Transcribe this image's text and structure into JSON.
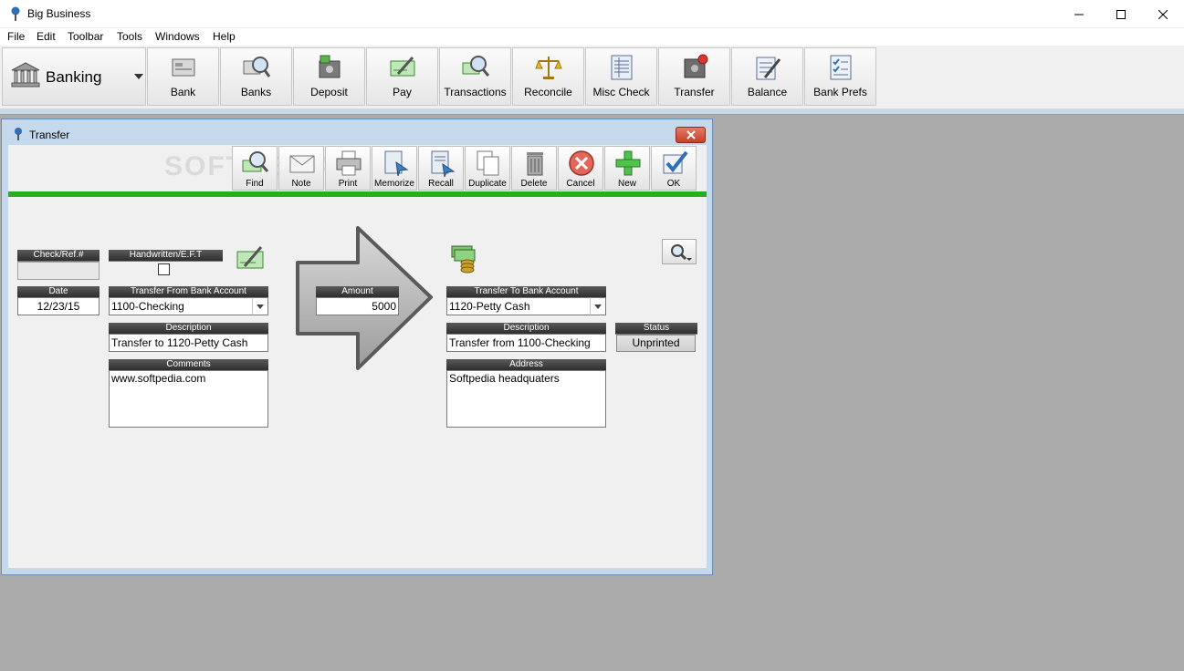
{
  "window": {
    "title": "Big Business"
  },
  "menu": [
    "File",
    "Edit",
    "Toolbar",
    "Tools",
    "Windows",
    "Help"
  ],
  "module": {
    "label": "Banking"
  },
  "toolbar": [
    {
      "label": "Bank",
      "icon": "bank-icon"
    },
    {
      "label": "Banks",
      "icon": "banks-search-icon"
    },
    {
      "label": "Deposit",
      "icon": "deposit-icon"
    },
    {
      "label": "Pay",
      "icon": "pay-icon"
    },
    {
      "label": "Transactions",
      "icon": "transactions-icon"
    },
    {
      "label": "Reconcile",
      "icon": "scales-icon"
    },
    {
      "label": "Misc Check",
      "icon": "misc-check-icon"
    },
    {
      "label": "Transfer",
      "icon": "transfer-icon"
    },
    {
      "label": "Balance",
      "icon": "balance-icon"
    },
    {
      "label": "Bank Prefs",
      "icon": "bank-prefs-icon"
    }
  ],
  "child": {
    "title": "Transfer",
    "toolbar": [
      {
        "label": "Find"
      },
      {
        "label": "Note"
      },
      {
        "label": "Print"
      },
      {
        "label": "Memorize"
      },
      {
        "label": "Recall"
      },
      {
        "label": "Duplicate"
      },
      {
        "label": "Delete"
      },
      {
        "label": "Cancel"
      },
      {
        "label": "New"
      },
      {
        "label": "OK"
      }
    ],
    "watermark": "SOFTPEDIA"
  },
  "form": {
    "check_ref": {
      "label": "Check/Ref.#",
      "value": ""
    },
    "handwritten": {
      "label": "Handwritten/E.F.T",
      "checked": false
    },
    "date": {
      "label": "Date",
      "value": "12/23/15"
    },
    "from_account": {
      "label": "Transfer From Bank Account",
      "value": "1100-Checking"
    },
    "from_description": {
      "label": "Description",
      "value": "Transfer to 1120-Petty Cash"
    },
    "comments": {
      "label": "Comments",
      "value": "www.softpedia.com"
    },
    "amount": {
      "label": "Amount",
      "value": "5000"
    },
    "to_account": {
      "label": "Transfer To Bank Account",
      "value": "1120-Petty Cash"
    },
    "to_description": {
      "label": "Description",
      "value": "Transfer from 1100-Checking"
    },
    "status": {
      "label": "Status",
      "value": "Unprinted"
    },
    "address": {
      "label": "Address",
      "value": "Softpedia headquaters"
    }
  }
}
